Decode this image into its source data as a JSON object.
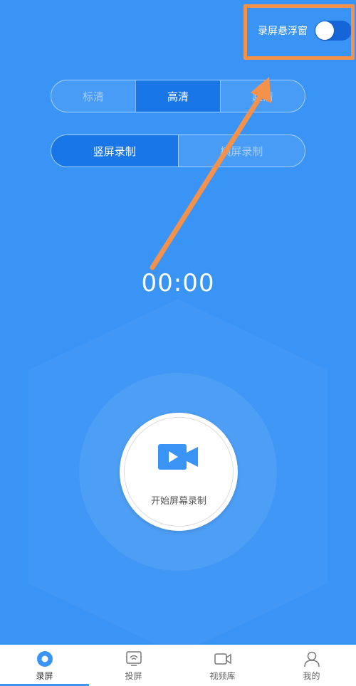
{
  "float_window": {
    "label": "录屏悬浮窗",
    "enabled": true
  },
  "quality": {
    "options": [
      "标清",
      "高清",
      "超清"
    ],
    "selected": "高清"
  },
  "orientation": {
    "options": [
      "竖屏录制",
      "横屏录制"
    ],
    "selected": "竖屏录制"
  },
  "timer": "00:00",
  "record_button": {
    "label": "开始屏幕录制",
    "icon": "video-camera-icon"
  },
  "tabs": [
    {
      "label": "录屏",
      "icon": "record-circle-icon",
      "active": true
    },
    {
      "label": "投屏",
      "icon": "cast-screen-icon",
      "active": false
    },
    {
      "label": "视频库",
      "icon": "video-library-icon",
      "active": false
    },
    {
      "label": "我的",
      "icon": "profile-icon",
      "active": false
    }
  ],
  "colors": {
    "background": "#3a94f5",
    "segment_active": "#1876e6",
    "annotation": "#f4914b",
    "switch_on": "#1565d8"
  }
}
